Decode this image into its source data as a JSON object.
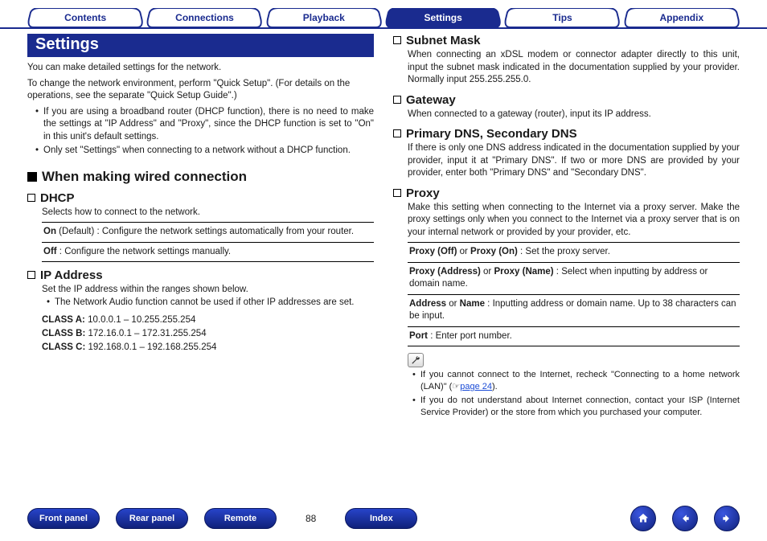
{
  "tabs": {
    "contents": "Contents",
    "connections": "Connections",
    "playback": "Playback",
    "settings": "Settings",
    "tips": "Tips",
    "appendix": "Appendix",
    "active": "settings"
  },
  "left": {
    "banner": "Settings",
    "intro1": "You can make detailed settings for the network.",
    "intro2": "To change the network environment, perform \"Quick Setup\". (For details on the operations, see the separate \"Quick Setup Guide\".)",
    "bullets": [
      "If you are using a broadband router (DHCP function), there is no need to make the settings at \"IP Address\" and \"Proxy\", since the DHCP function is set to \"On\" in this unit's default settings.",
      "Only set \"Settings\" when connecting to a network without a DHCP function."
    ],
    "h_wired": "When making wired connection",
    "dhcp": {
      "title": "DHCP",
      "desc": "Selects how to connect to the network.",
      "rows": [
        {
          "b": "On",
          "t": " (Default) : Configure the network settings automatically from your router."
        },
        {
          "b": "Off",
          "t": " : Configure the network settings manually."
        }
      ]
    },
    "ip": {
      "title": "IP Address",
      "desc": "Set the IP address within the ranges shown below.",
      "note": "The Network Audio function cannot be used if other IP addresses are set.",
      "classes": [
        {
          "b": "CLASS A:",
          "t": " 10.0.0.1 – 10.255.255.254"
        },
        {
          "b": "CLASS B:",
          "t": " 172.16.0.1 – 172.31.255.254"
        },
        {
          "b": "CLASS C:",
          "t": " 192.168.0.1 – 192.168.255.254"
        }
      ]
    }
  },
  "right": {
    "subnet": {
      "title": "Subnet Mask",
      "desc": "When connecting an xDSL modem or connector adapter directly to this unit, input the subnet mask indicated in the documentation supplied by your provider. Normally input 255.255.255.0."
    },
    "gateway": {
      "title": "Gateway",
      "desc": "When connected to a gateway (router), input its IP address."
    },
    "dns": {
      "title": "Primary DNS, Secondary DNS",
      "desc": "If there is only one DNS address indicated in the documentation supplied by your provider, input it at \"Primary DNS\". If two or more DNS are provided by your provider, enter both \"Primary DNS\" and \"Secondary DNS\"."
    },
    "proxy": {
      "title": "Proxy",
      "desc": "Make this setting when connecting to the Internet via a proxy server. Make the proxy settings only when you connect to the Internet via a proxy server that is on your internal network or provided by your provider, etc.",
      "rows": [
        {
          "b1": "Proxy (Off)",
          "m": " or ",
          "b2": "Proxy (On)",
          "t": " : Set the proxy server."
        },
        {
          "b1": "Proxy (Address)",
          "m": " or ",
          "b2": "Proxy (Name)",
          "t": " : Select when inputting by address or domain name."
        },
        {
          "b1": "Address",
          "m": " or ",
          "b2": "Name",
          "t": " : Inputting address or domain name. Up to 38 characters can be input."
        },
        {
          "b1": "Port",
          "m": "",
          "b2": "",
          "t": " : Enter port number."
        }
      ],
      "tips": [
        {
          "pre": "If you cannot connect to the Internet, recheck \"Connecting to a home network (LAN)\" (☞",
          "link": "page 24",
          "post": ")."
        },
        {
          "pre": "If you do not understand about Internet connection, contact your ISP (Internet Service Provider) or the store from which you purchased your computer.",
          "link": "",
          "post": ""
        }
      ]
    }
  },
  "bottom": {
    "front": "Front panel",
    "rear": "Rear panel",
    "remote": "Remote",
    "page": "88",
    "index": "Index"
  }
}
